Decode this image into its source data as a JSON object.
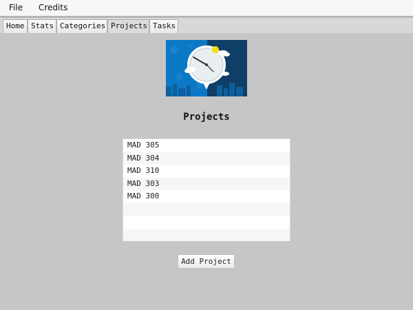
{
  "menubar": {
    "items": [
      {
        "label": "File"
      },
      {
        "label": "Credits"
      }
    ]
  },
  "tabs": [
    {
      "label": "Home",
      "active": false
    },
    {
      "label": "Stats",
      "active": false
    },
    {
      "label": "Categories",
      "active": false
    },
    {
      "label": "Projects",
      "active": true
    },
    {
      "label": "Tasks",
      "active": false
    }
  ],
  "main": {
    "title": "Projects",
    "projects": [
      {
        "name": "MAD 305"
      },
      {
        "name": "MAD 304"
      },
      {
        "name": "MAD 310"
      },
      {
        "name": "MAD 303"
      },
      {
        "name": "MAD 300"
      },
      {
        "name": ""
      },
      {
        "name": ""
      },
      {
        "name": ""
      }
    ],
    "add_button_label": "Add Project"
  },
  "theme": {
    "background": "#c6c6c6",
    "accent_blue": "#0b79c6",
    "hero_dark": "#0f3f66",
    "sun": "#f4e100"
  }
}
